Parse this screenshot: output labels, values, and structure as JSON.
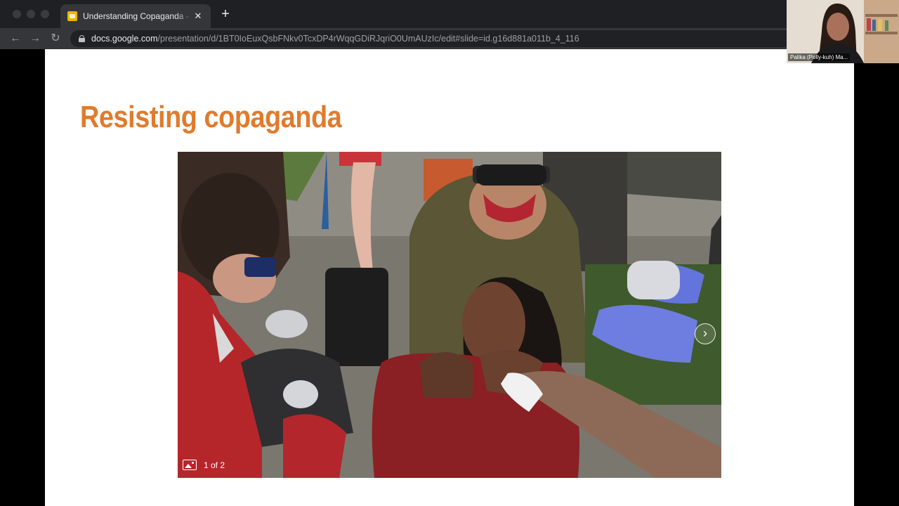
{
  "browser": {
    "tab": {
      "title": "Understanding Copaganda - G",
      "close_glyph": "✕",
      "favicon": "google-slides-icon"
    },
    "new_tab_glyph": "+",
    "nav": {
      "back_glyph": "←",
      "forward_glyph": "→",
      "reload_glyph": "↻"
    },
    "url": {
      "host": "docs.google.com",
      "path": "/presentation/d/1BT0IoEuxQsbFNkv0TcxDP4rWqqGDiRJqriO0UmAUzIc/edit#slide=id.g16d881a011b_4_116"
    }
  },
  "slide": {
    "title": "Resisting copaganda",
    "title_color": "#e07b2c",
    "image": {
      "counter": "1 of 2",
      "next_glyph": "›",
      "icons": [
        "gallery-icon",
        "chevron-right-icon"
      ]
    }
  },
  "webcam": {
    "participant_name": "Palika (Polly-kuh) Ma..."
  },
  "colors": {
    "tabstrip": "#1f2024",
    "toolbar": "#35363a",
    "omnibox": "#202124",
    "slide_bg": "#ffffff"
  }
}
